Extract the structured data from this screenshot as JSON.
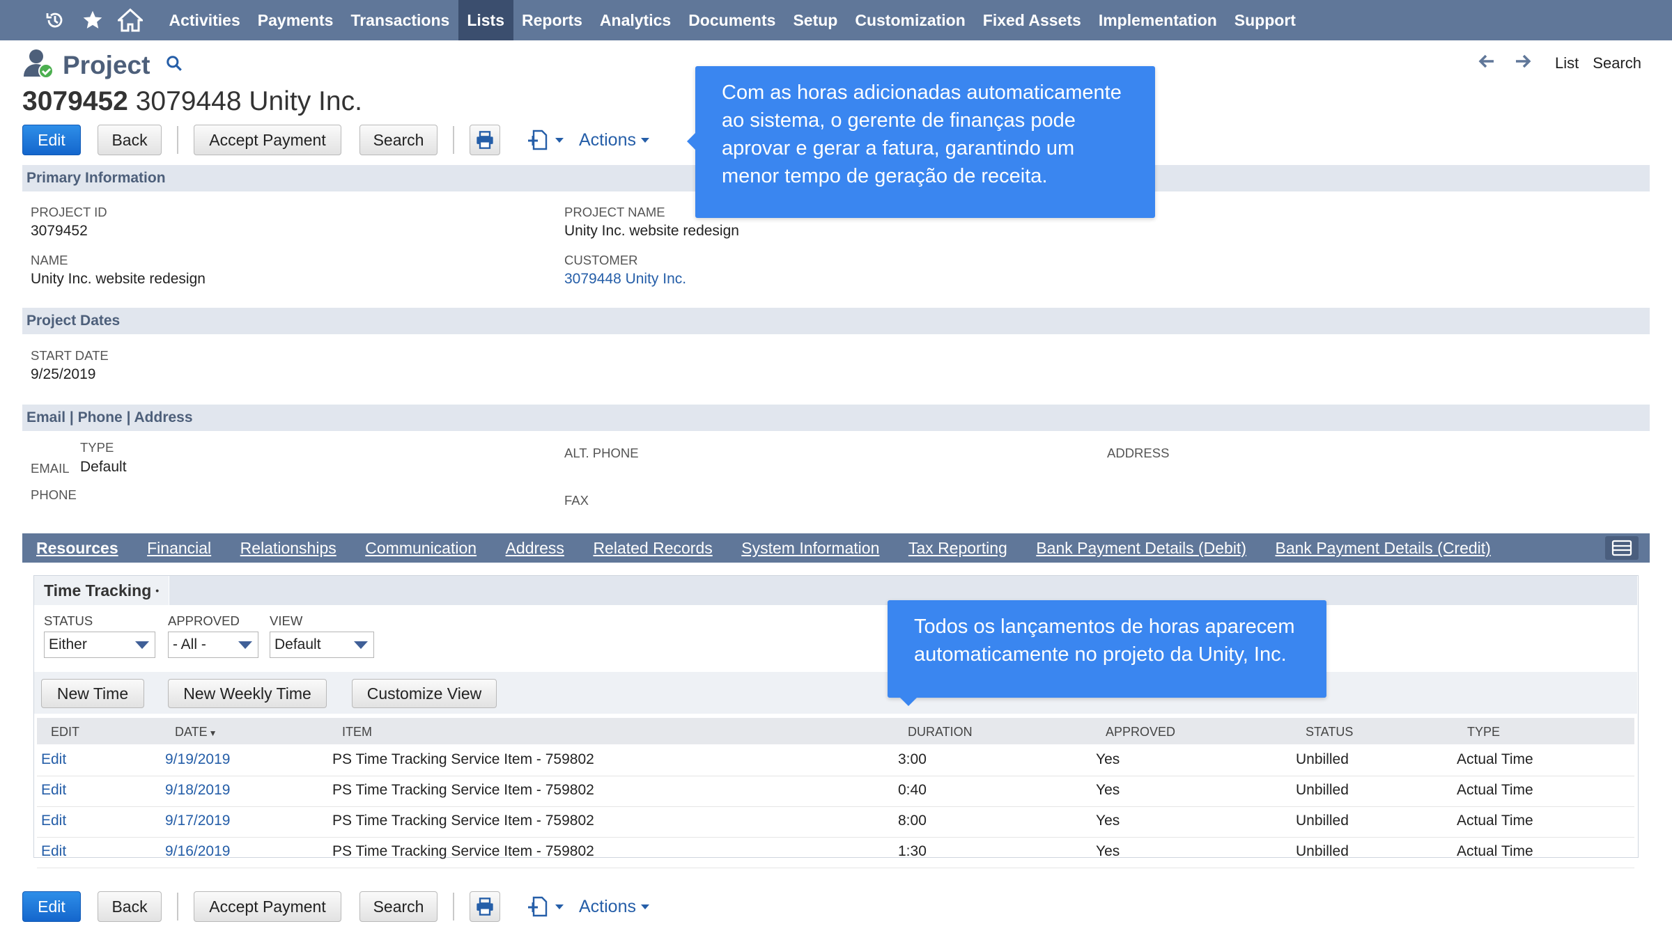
{
  "nav": {
    "icons": [
      "recent-icon",
      "star-icon",
      "home-icon"
    ],
    "items": [
      "Activities",
      "Payments",
      "Transactions",
      "Lists",
      "Reports",
      "Analytics",
      "Documents",
      "Setup",
      "Customization",
      "Fixed Assets",
      "Implementation",
      "Support"
    ],
    "active": "Lists"
  },
  "header": {
    "page_title": "Project",
    "record_number": "3079452",
    "record_rest": "3079448 Unity Inc.",
    "list_link": "List",
    "search_link": "Search"
  },
  "buttons": {
    "edit": "Edit",
    "back": "Back",
    "accept_payment": "Accept Payment",
    "search": "Search",
    "actions": "Actions"
  },
  "primary": {
    "title": "Primary Information",
    "project_id_label": "PROJECT ID",
    "project_id": "3079452",
    "project_name_label": "PROJECT NAME",
    "project_name": "Unity Inc. website redesign",
    "name_label": "NAME",
    "name": "Unity Inc. website redesign",
    "customer_label": "CUSTOMER",
    "customer": "3079448 Unity Inc."
  },
  "dates": {
    "title": "Project Dates",
    "start_label": "START DATE",
    "start": "9/25/2019"
  },
  "contact": {
    "title": "Email | Phone | Address",
    "type_label": "TYPE",
    "email_label": "EMAIL",
    "email_type": "Default",
    "phone_label": "PHONE",
    "alt_phone_label": "ALT. PHONE",
    "fax_label": "FAX",
    "address_label": "ADDRESS"
  },
  "tabs": [
    "Resources",
    "Financial",
    "Relationships",
    "Communication",
    "Address",
    "Related Records",
    "System Information",
    "Tax Reporting",
    "Bank Payment Details (Debit)",
    "Bank Payment Details (Credit)"
  ],
  "time_tracking": {
    "subtab": "Time Tracking",
    "status_label": "STATUS",
    "status_value": "Either",
    "approved_label": "APPROVED",
    "approved_value": "- All -",
    "view_label": "VIEW",
    "view_value": "Default",
    "new_time": "New Time",
    "new_weekly_time": "New Weekly Time",
    "customize_view": "Customize View",
    "columns": [
      "EDIT",
      "DATE",
      "ITEM",
      "DURATION",
      "APPROVED",
      "STATUS",
      "TYPE"
    ],
    "rows": [
      {
        "edit": "Edit",
        "date": "9/19/2019",
        "item": "PS Time Tracking Service Item - 759802",
        "duration": "3:00",
        "approved": "Yes",
        "status": "Unbilled",
        "type": "Actual Time"
      },
      {
        "edit": "Edit",
        "date": "9/18/2019",
        "item": "PS Time Tracking Service Item - 759802",
        "duration": "0:40",
        "approved": "Yes",
        "status": "Unbilled",
        "type": "Actual Time"
      },
      {
        "edit": "Edit",
        "date": "9/17/2019",
        "item": "PS Time Tracking Service Item - 759802",
        "duration": "8:00",
        "approved": "Yes",
        "status": "Unbilled",
        "type": "Actual Time"
      },
      {
        "edit": "Edit",
        "date": "9/16/2019",
        "item": "PS Time Tracking Service Item - 759802",
        "duration": "1:30",
        "approved": "Yes",
        "status": "Unbilled",
        "type": "Actual Time"
      }
    ]
  },
  "callouts": {
    "top_lines": [
      "Com as horas adicionadas automaticamente",
      "ao sistema, o gerente de finanças pode",
      "aprovar e gerar a fatura, garantindo um",
      "menor tempo de geração de receita."
    ],
    "mid_lines": [
      "Todos os lançamentos de horas aparecem",
      "automaticamente no projeto da Unity, Inc."
    ]
  },
  "colors": {
    "nav_bg": "#607799",
    "nav_active": "#3b4e6e",
    "primary_button": "#1a73d9",
    "link": "#255ea8",
    "callout": "#3a86f0",
    "section_bg": "#e1e6ee"
  }
}
